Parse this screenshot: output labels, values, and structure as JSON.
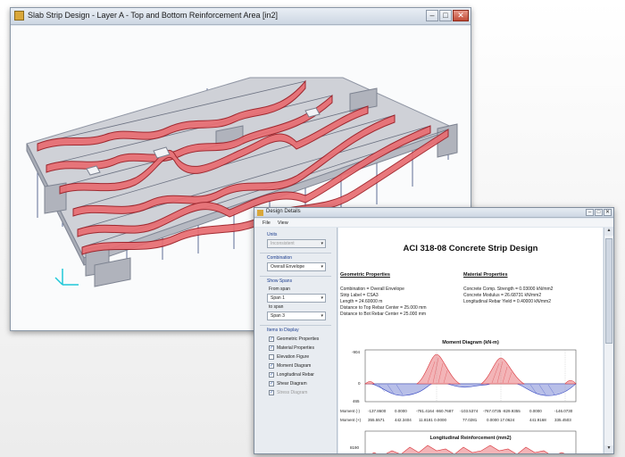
{
  "main_window": {
    "title": "Slab Strip Design - Layer A - Top and Bottom Reinforcement Area [in2]",
    "controls": {
      "minimize": "–",
      "maximize": "□",
      "close": "✕"
    }
  },
  "dialog": {
    "title": "Design Details",
    "menu": [
      "File",
      "View"
    ],
    "controls": {
      "minimize": "–",
      "maximize": "□",
      "close": "✕"
    },
    "panel": {
      "units_label": "Units",
      "units_value": "Inconsistent",
      "combination_label": "Combination",
      "combination_value": "Overall Envelope",
      "show_spans_label": "Show Spans",
      "from_span_label": "From span",
      "from_span_value": "Span 1",
      "to_span_label": "to span",
      "to_span_value": "Span 3",
      "items_label": "Items to Display",
      "items": [
        {
          "label": "Geometric Properties",
          "checked": true,
          "enabled": true
        },
        {
          "label": "Material Properties",
          "checked": true,
          "enabled": true
        },
        {
          "label": "Elevation Figure",
          "checked": false,
          "enabled": true
        },
        {
          "label": "Moment Diagram",
          "checked": true,
          "enabled": true
        },
        {
          "label": "Longitudinal Rebar",
          "checked": true,
          "enabled": true
        },
        {
          "label": "Shear Diagram",
          "checked": true,
          "enabled": true
        },
        {
          "label": "Stress Diagram",
          "checked": true,
          "enabled": false
        }
      ]
    },
    "report": {
      "title": "ACI 318-08 Concrete Strip Design",
      "geometric": {
        "heading": "Geometric Properties",
        "lines": [
          "Combination = Overall Envelope",
          "Strip Label = CSA3",
          "Length = 24.60000 m",
          "Distance to Top Rebar Center = 25.000 mm",
          "Distance to Bot Rebar Center = 25.000 mm"
        ]
      },
      "material": {
        "heading": "Material Properties",
        "lines": [
          "Concrete Comp. Strength = 0.03000 kN/mm2",
          "Concrete Modulus = 26.68731 kN/mm2",
          "Longitudinal Rebar Yield = 0.40000 kN/mm2"
        ]
      },
      "moment": {
        "title": "Moment Diagram (kN-m)",
        "tick_top": "-904",
        "tick_mid": "0",
        "tick_bot": "465",
        "row_neg_label": "Moment (-)",
        "row_pos_label": "Moment (+)",
        "row_neg": [
          "-137.8600",
          "0.0000",
          "-781.4164 -860.7687",
          "-103.5374",
          "-767.0735 -829.9355",
          "0.0000",
          "-146.0730"
        ],
        "row_pos": [
          "355.5571",
          "442.3404",
          "11.8181 0.0000",
          "77.0281",
          "0.0000 17.0624",
          "441.9168",
          "335.4503"
        ]
      },
      "rebar": {
        "title": "Longitudinal Reinforcement (mm2)",
        "tick_top": "8190"
      }
    },
    "scroll": {
      "up": "▲",
      "down": "▼"
    }
  },
  "colors": {
    "negative_moment": "#d9343a",
    "positive_moment": "#3446c2",
    "slab": "#c9cbd1",
    "column": "#4a5a8a",
    "strip_fill": "#e86d72"
  }
}
